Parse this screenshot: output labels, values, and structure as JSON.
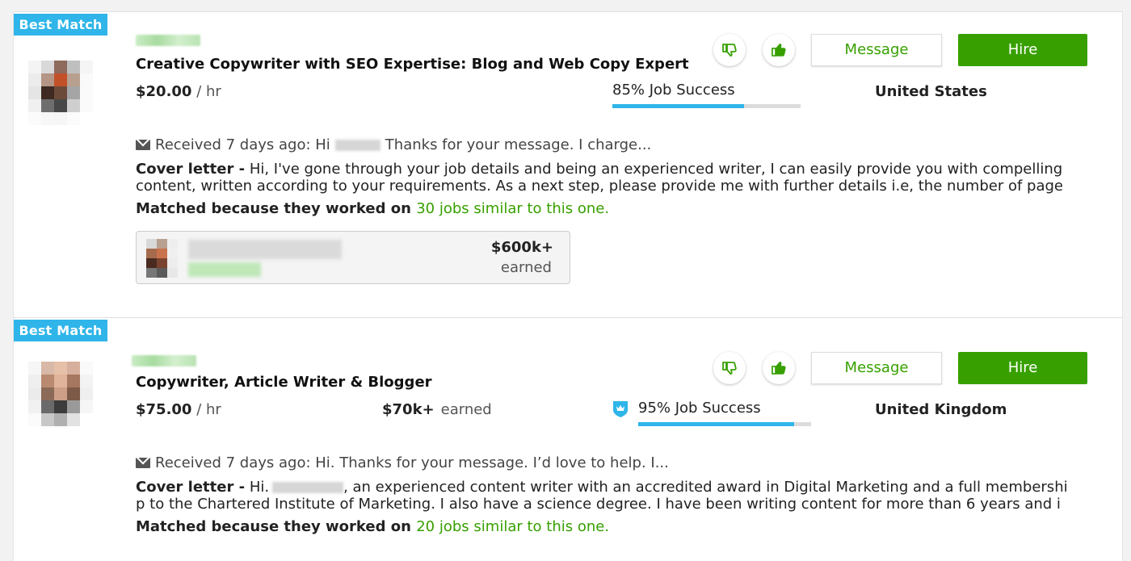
{
  "cards": [
    {
      "badge": "Best Match",
      "title": "Creative Copywriter with SEO Expertise: Blog and Web Copy Expert",
      "rate_amount": "$20.00",
      "rate_unit": "/ hr",
      "job_success": "85% Job Success",
      "job_success_pct": 0.7,
      "country": "United States",
      "message_label": "Message",
      "hire_label": "Hire",
      "received_prefix": "Received 7 days ago: Hi",
      "received_rest": "Thanks for your message. I charge...",
      "cover_label": "Cover letter -",
      "cover_text": "Hi, I've gone through your job details and being an experienced writer, I can easily provide you with compelling content, written according to your requirements. As a next step, please provide me with further details i.e, the number of page",
      "matched_prefix": "Matched because they worked on",
      "matched_link": "30 jobs similar to this one.",
      "earned_amount": "$600k+",
      "earned_label": "earned"
    },
    {
      "badge": "Best Match",
      "title": "Copywriter, Article Writer & Blogger",
      "rate_amount": "$75.00",
      "rate_unit": "/ hr",
      "earned_amount": "$70k+",
      "earned_label": "earned",
      "job_success": "95% Job Success",
      "job_success_pct": 0.9,
      "country": "United Kingdom",
      "message_label": "Message",
      "hire_label": "Hire",
      "received_text": "Received 7 days ago: Hi. Thanks for your message. I’d love to help. I...",
      "cover_label": "Cover letter -",
      "cover_prefix": "Hi.",
      "cover_text_1": ", an experienced content writer with an accredited award in Digital Marketing and a full membershi",
      "cover_text_2": "p to the Chartered Institute of Marketing. I also have a science degree. I have been writing content for more than 6 years and i",
      "matched_prefix": "Matched because they worked on",
      "matched_link": "20 jobs similar to this one."
    }
  ],
  "icons": {
    "dislike": "thumbs-down-icon",
    "like": "thumbs-up-icon",
    "mail": "envelope-icon",
    "top_rated": "crown-shield-icon"
  },
  "colors": {
    "badge": "#2fb5e9",
    "green": "#37a000",
    "progress": "#2fb5e9"
  }
}
